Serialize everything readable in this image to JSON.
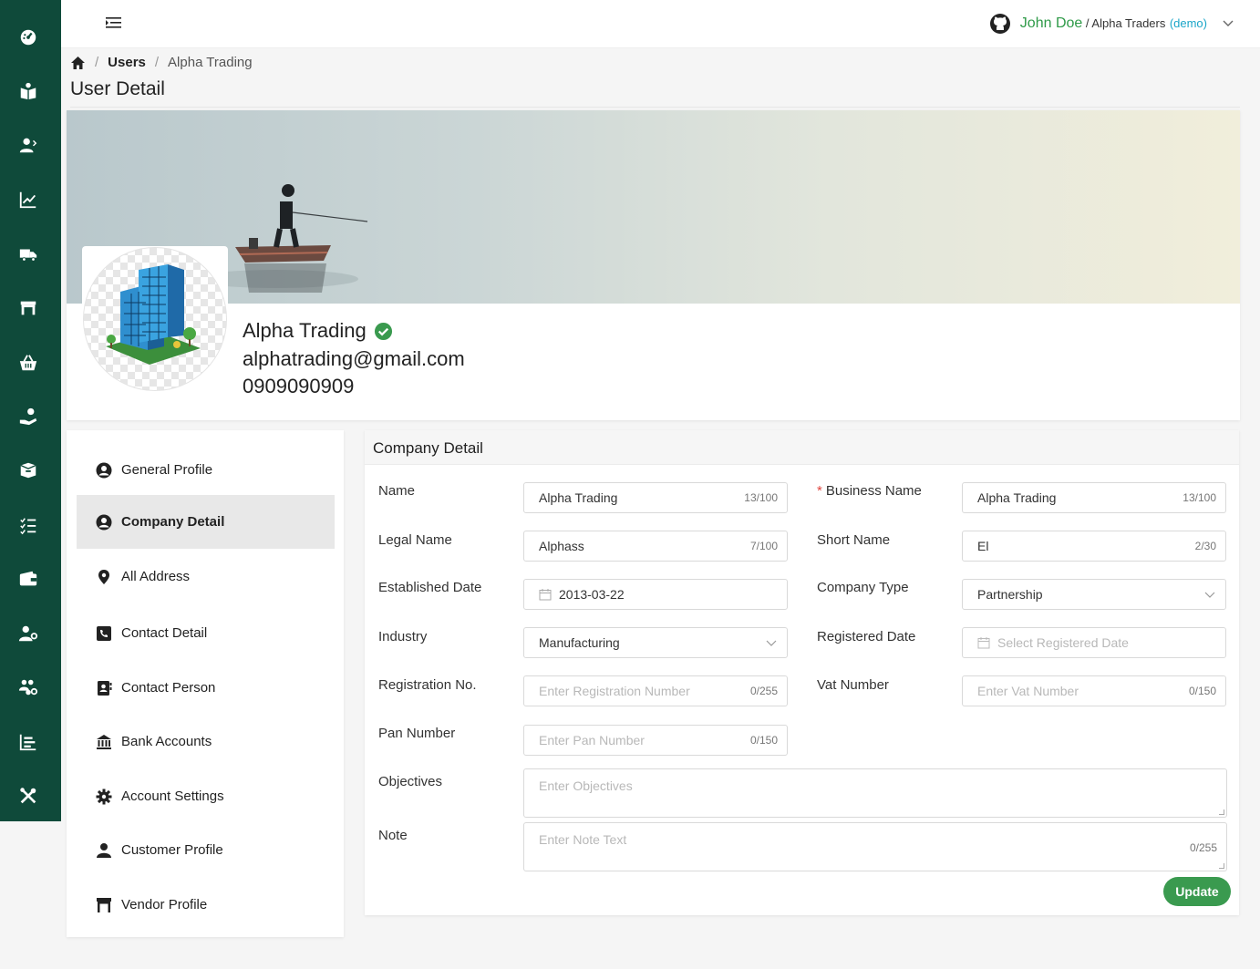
{
  "header": {
    "user_name": "John Doe",
    "separator": " / ",
    "company": "Alpha Traders",
    "demo": "(demo)"
  },
  "breadcrumb": {
    "users": "Users",
    "sep": "/",
    "current": "Alpha Trading"
  },
  "page_title": "User Detail",
  "profile": {
    "name": "Alpha Trading",
    "email": "alphatrading@gmail.com",
    "phone": "0909090909"
  },
  "nav": {
    "items": [
      {
        "label": "General Profile",
        "icon": "user-circle-icon"
      },
      {
        "label": "Company Detail",
        "icon": "user-circle-icon",
        "active": true
      },
      {
        "label": "All Address",
        "icon": "map-pin-icon"
      },
      {
        "label": "Contact Detail",
        "icon": "phone-icon"
      },
      {
        "label": "Contact Person",
        "icon": "contact-book-icon"
      },
      {
        "label": "Bank Accounts",
        "icon": "bank-icon"
      },
      {
        "label": "Account Settings",
        "icon": "gear-icon"
      },
      {
        "label": "Customer Profile",
        "icon": "user-icon"
      },
      {
        "label": "Vendor Profile",
        "icon": "store-icon"
      }
    ]
  },
  "detail": {
    "title": "Company Detail",
    "fields": {
      "name": {
        "label": "Name",
        "value": "Alpha Trading",
        "count": "13/100"
      },
      "business_name": {
        "label": "Business Name",
        "required": "*",
        "value": "Alpha Trading",
        "count": "13/100"
      },
      "legal_name": {
        "label": "Legal Name",
        "value": "Alphass",
        "count": "7/100"
      },
      "short_name": {
        "label": "Short Name",
        "value": "El",
        "count": "2/30"
      },
      "established_date": {
        "label": "Established Date",
        "value": "2013-03-22"
      },
      "company_type": {
        "label": "Company Type",
        "value": "Partnership"
      },
      "industry": {
        "label": "Industry",
        "value": "Manufacturing"
      },
      "registered_date": {
        "label": "Registered Date",
        "placeholder": "Select Registered Date"
      },
      "registration_no": {
        "label": "Registration No.",
        "placeholder": "Enter Registration Number",
        "count": "0/255"
      },
      "vat_number": {
        "label": "Vat Number",
        "placeholder": "Enter Vat Number",
        "count": "0/150"
      },
      "pan_number": {
        "label": "Pan Number",
        "placeholder": "Enter Pan Number",
        "count": "0/150"
      },
      "objectives": {
        "label": "Objectives",
        "placeholder": "Enter Objectives"
      },
      "note": {
        "label": "Note",
        "placeholder": "Enter Note Text",
        "count": "0/255"
      }
    },
    "update_label": "Update"
  },
  "sidebar_icons": [
    "dashboard-icon",
    "book-user-icon",
    "user-arrow-icon",
    "chart-line-icon",
    "truck-icon",
    "store-icon",
    "basket-icon",
    "hand-money-icon",
    "box-icon",
    "checklist-icon",
    "wallet-icon",
    "user-gear-icon",
    "users-gear-icon",
    "report-list-icon",
    "tools-icon"
  ],
  "colors": {
    "sidebar": "#0f4a3a",
    "accent_green": "#3a9a4f",
    "user_name": "#2e9a48",
    "demo": "#1aa5c8"
  }
}
